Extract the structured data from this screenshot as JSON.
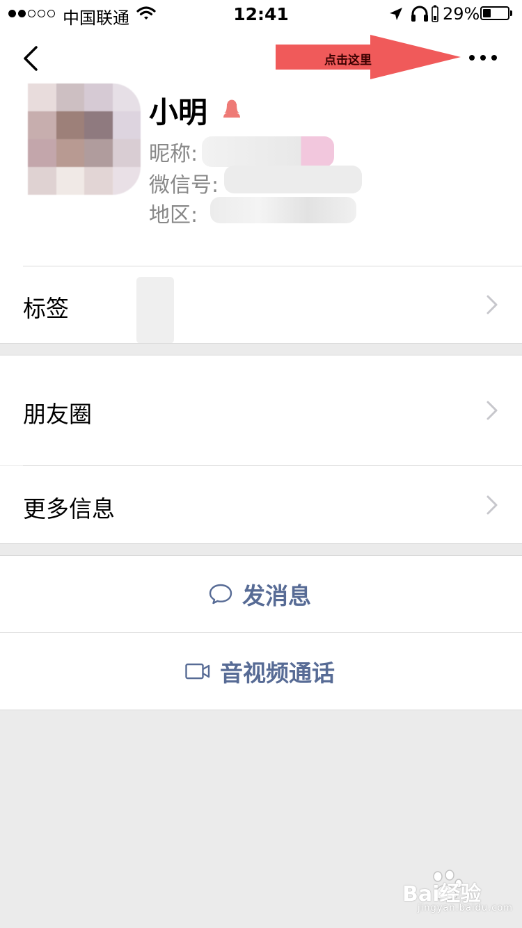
{
  "status_bar": {
    "carrier": "中国联通",
    "time": "12:41",
    "battery_percent": "29%",
    "signal_bars_filled": 2,
    "signal_bars_total": 5,
    "icons": [
      "wifi-icon",
      "location-arrow-icon",
      "headphones-icon",
      "battery-icon"
    ]
  },
  "header": {
    "back_icon": "chevron-left-icon",
    "more_icon": "more-dots-icon"
  },
  "annotation": {
    "label": "点击这里",
    "color": "#f05a5a"
  },
  "profile": {
    "name": "小明",
    "gender_icon": "female-user-icon",
    "nickname_label": "昵称:",
    "wechat_id_label": "微信号:",
    "region_label": "地区:"
  },
  "menu": {
    "tags_label": "标签",
    "moments_label": "朋友圈",
    "more_info_label": "更多信息"
  },
  "actions": {
    "message_label": "发消息",
    "video_call_label": "音视频通话",
    "accent_color": "#576b95"
  },
  "watermark": {
    "text": "Bai经验",
    "sub": "jingyan.baidu.com"
  }
}
